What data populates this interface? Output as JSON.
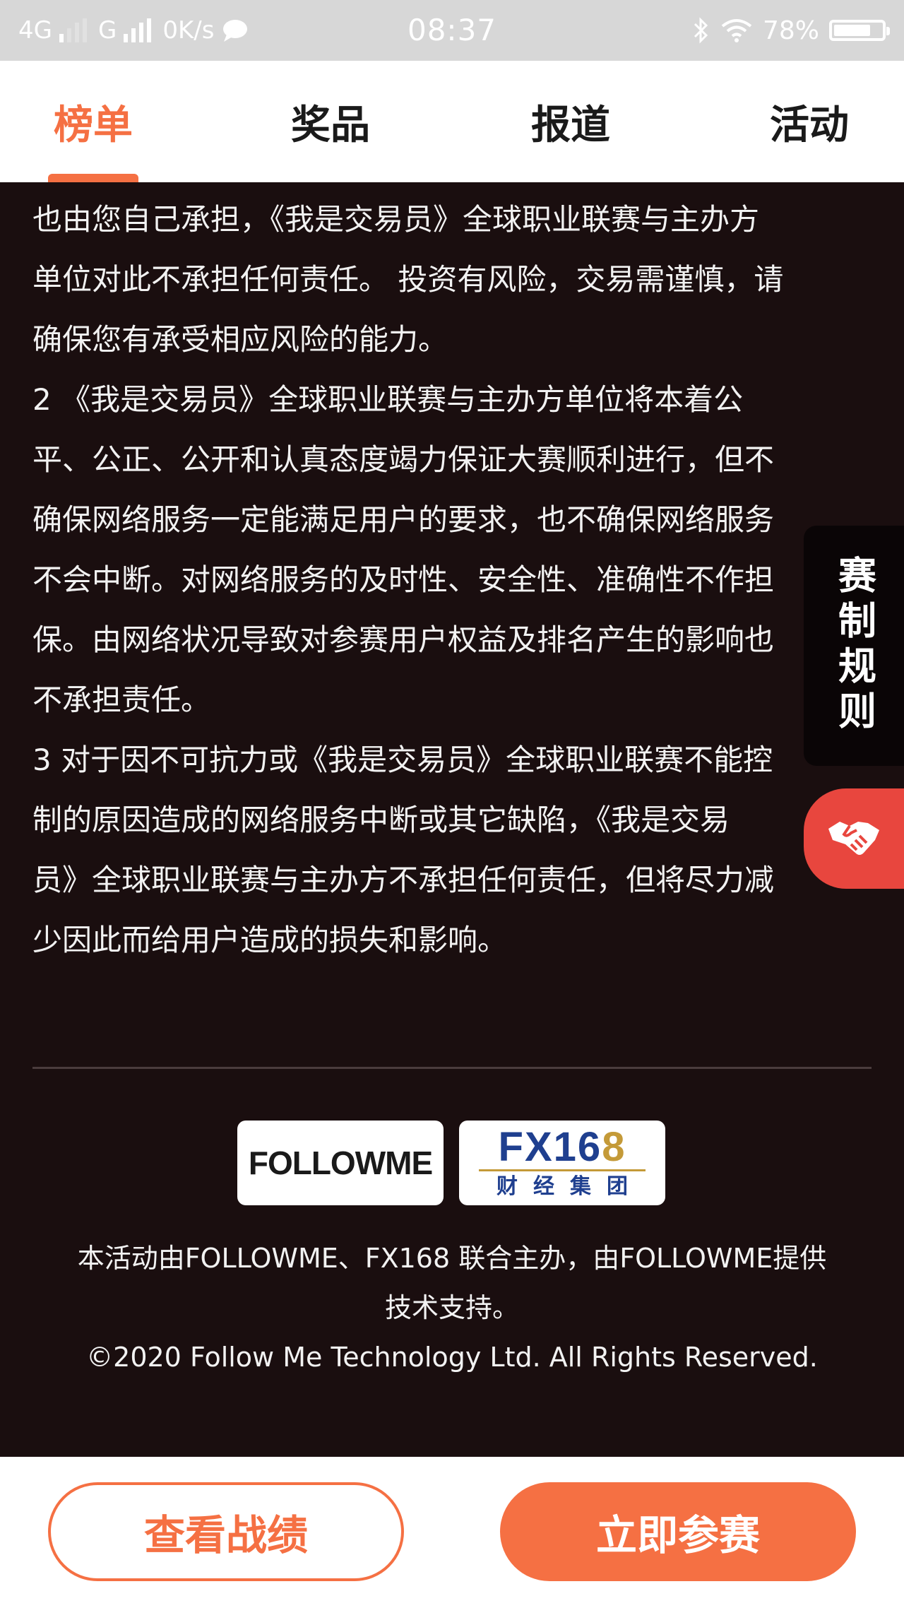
{
  "status_bar": {
    "network1": "4G",
    "network2": "G",
    "speed": "0K/s",
    "time": "08:37",
    "battery": "78%",
    "battery_level": 0.78,
    "icons": [
      "signal-icon",
      "chat-icon",
      "bluetooth-icon",
      "wifi-icon",
      "battery-icon"
    ]
  },
  "tabs": [
    {
      "label": "榜单",
      "active": true
    },
    {
      "label": "奖品",
      "active": false
    },
    {
      "label": "报道",
      "active": false
    },
    {
      "label": "活动",
      "active": false
    }
  ],
  "content": {
    "lines": [
      "也由您自己承担，《我是交易员》全球职业联赛与主办方",
      "单位对此不承担任何责任。 投资有风险，交易需谨慎，请",
      "确保您有承受相应风险的能力。",
      "2 《我是交易员》全球职业联赛与主办方单位将本着公",
      "平、公正、公开和认真态度竭力保证大赛顺利进行，但不",
      "确保网络服务一定能满足用户的要求，也不确保网络服务",
      "不会中断。对网络服务的及时性、安全性、准确性不作担",
      "保。由网络状况导致对参赛用户权益及排名产生的影响也",
      "不承担责任。",
      "3 对于因不可抗力或《我是交易员》全球职业联赛不能控",
      "制的原因造成的网络服务中断或其它缺陷，《我是交易",
      "员》全球职业联赛与主办方不承担任何责任，但将尽力减",
      "少因此而给用户造成的损失和影响。"
    ]
  },
  "logos": {
    "followme": "FOLLOWME",
    "fx168_main": "FX16",
    "fx168_gold": "8",
    "fx168_sub": "财经集团"
  },
  "footer": {
    "line1": "本活动由FOLLOWME、FX168 联合主办，由FOLLOWME提供",
    "line2": "技术支持。",
    "copyright": "©2020 Follow Me Technology Ltd. All Rights Reserved."
  },
  "side": {
    "rules_label": "赛制规则",
    "partner_icon": "handshake-icon"
  },
  "bottom": {
    "view_results": "查看战绩",
    "join_now": "立即参赛"
  },
  "colors": {
    "accent": "#f57043",
    "background": "#1a0e0f",
    "partner_red": "#e8463e"
  }
}
